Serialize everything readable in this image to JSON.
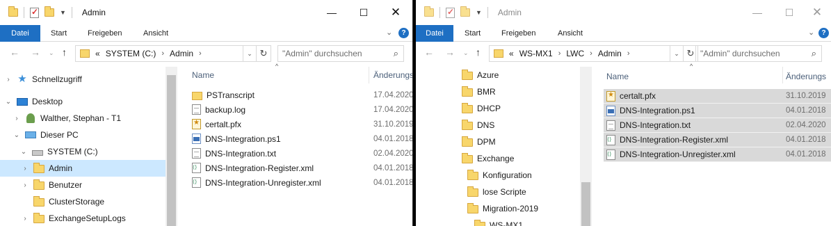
{
  "left": {
    "title": "Admin",
    "ribbon_tabs": [
      "Datei",
      "Start",
      "Freigeben",
      "Ansicht"
    ],
    "address": {
      "prefix": "«",
      "segments": [
        "SYSTEM (C:)",
        "Admin"
      ]
    },
    "search_placeholder": "\"Admin\" durchsuchen",
    "tree": [
      {
        "label": "Schnellzugriff",
        "icon": "quick-access-star-icon",
        "expander": "›"
      },
      {
        "label": "Desktop",
        "icon": "desktop-icon",
        "expander": "⌄"
      },
      {
        "label": "Walther, Stephan - T1",
        "icon": "user-icon",
        "expander": "›"
      },
      {
        "label": "Dieser PC",
        "icon": "pc-icon",
        "expander": "⌄"
      },
      {
        "label": "SYSTEM (C:)",
        "icon": "drive-icon",
        "expander": "⌄"
      },
      {
        "label": "Admin",
        "icon": "folder-icon",
        "expander": "›"
      },
      {
        "label": "Benutzer",
        "icon": "folder-icon",
        "expander": "›"
      },
      {
        "label": "ClusterStorage",
        "icon": "folder-icon",
        "expander": ""
      },
      {
        "label": "ExchangeSetupLogs",
        "icon": "folder-icon",
        "expander": "›"
      }
    ],
    "columns": {
      "name": "Name",
      "date": "Änderungs"
    },
    "files": [
      {
        "name": "PSTranscript",
        "date": "17.04.2020",
        "type": "folder"
      },
      {
        "name": "backup.log",
        "date": "17.04.2020",
        "type": "doc"
      },
      {
        "name": "certalt.pfx",
        "date": "31.10.2019",
        "type": "pfx"
      },
      {
        "name": "DNS-Integration.ps1",
        "date": "04.01.2018",
        "type": "ps1"
      },
      {
        "name": "DNS-Integration.txt",
        "date": "02.04.2020",
        "type": "doc"
      },
      {
        "name": "DNS-Integration-Register.xml",
        "date": "04.01.2018",
        "type": "xml"
      },
      {
        "name": "DNS-Integration-Unregister.xml",
        "date": "04.01.2018",
        "type": "xml"
      }
    ]
  },
  "right": {
    "title": "Admin",
    "ribbon_tabs": [
      "Datei",
      "Start",
      "Freigeben",
      "Ansicht"
    ],
    "address": {
      "prefix": "«",
      "segments": [
        "WS-MX1",
        "LWC",
        "Admin"
      ]
    },
    "search_placeholder": "\"Admin\" durchsuchen",
    "tree": [
      {
        "label": "Azure"
      },
      {
        "label": "BMR"
      },
      {
        "label": "DHCP"
      },
      {
        "label": "DNS"
      },
      {
        "label": "DPM"
      },
      {
        "label": "Exchange"
      },
      {
        "label": "Konfiguration"
      },
      {
        "label": "lose Scripte"
      },
      {
        "label": "Migration-2019"
      },
      {
        "label": "WS-MX1"
      }
    ],
    "columns": {
      "name": "Name",
      "date": "Änderungs"
    },
    "files": [
      {
        "name": "certalt.pfx",
        "date": "31.10.2019",
        "type": "pfx"
      },
      {
        "name": "DNS-Integration.ps1",
        "date": "04.01.2018",
        "type": "ps1"
      },
      {
        "name": "DNS-Integration.txt",
        "date": "02.04.2020",
        "type": "doc"
      },
      {
        "name": "DNS-Integration-Register.xml",
        "date": "04.01.2018",
        "type": "xml"
      },
      {
        "name": "DNS-Integration-Unregister.xml",
        "date": "04.01.2018",
        "type": "xml"
      }
    ]
  },
  "icons": {
    "minimize": "minimize-icon",
    "maximize": "maximize-icon",
    "close": "close-icon",
    "back": "back-arrow-icon",
    "forward": "forward-arrow-icon",
    "recent": "chevron-down-icon",
    "up": "up-arrow-icon",
    "refresh": "refresh-icon",
    "search": "search-icon",
    "help": "help-icon"
  },
  "colors": {
    "accent": "#1e6fc3",
    "tree_selected": "#cce8ff",
    "list_selected": "#d9d9d9",
    "folder": "#f8d66b"
  }
}
